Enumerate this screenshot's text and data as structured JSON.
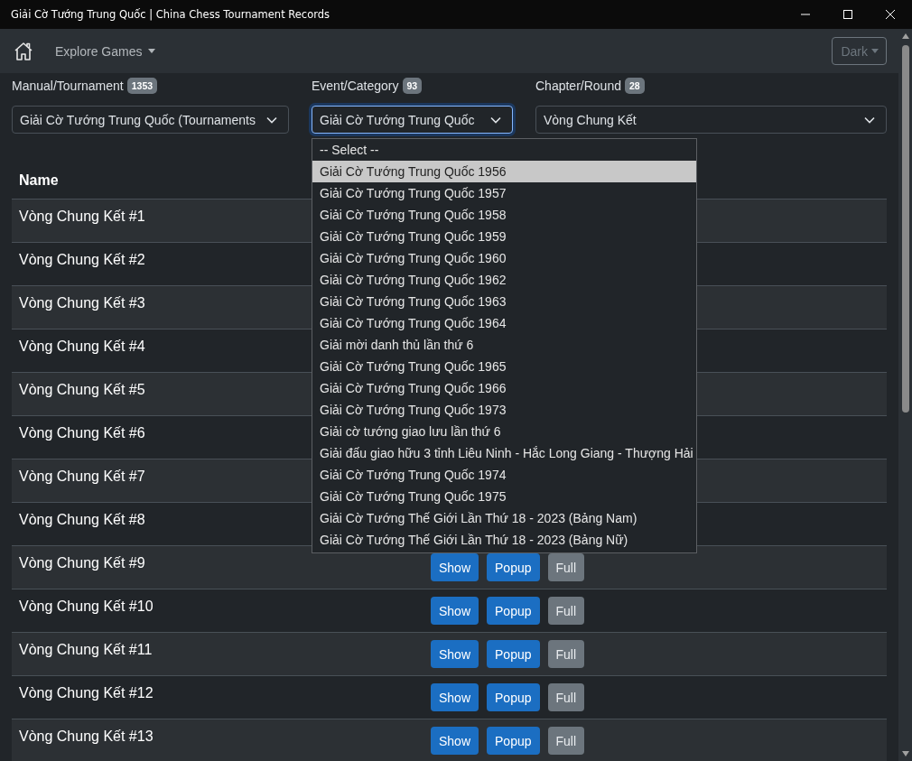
{
  "window": {
    "title": "Giải Cờ Tướng Trung Quốc | China Chess Tournament Records"
  },
  "navbar": {
    "menu": "Explore Games",
    "theme_button": "Dark"
  },
  "filters": [
    {
      "label": "Manual/Tournament",
      "count": "1353",
      "value": "Giải Cờ Tướng Trung Quốc (Tournaments",
      "focused": false
    },
    {
      "label": "Event/Category",
      "count": "93",
      "value": "Giải Cờ Tướng Trung Quốc",
      "focused": true
    },
    {
      "label": "Chapter/Round",
      "count": "28",
      "value": "Vòng Chung Kết",
      "focused": false
    }
  ],
  "dropdown": {
    "options": [
      {
        "label": "-- Select --",
        "selected": false
      },
      {
        "label": "Giải Cờ Tướng Trung Quốc 1956",
        "selected": true
      },
      {
        "label": "Giải Cờ Tướng Trung Quốc 1957",
        "selected": false
      },
      {
        "label": "Giải Cờ Tướng Trung Quốc 1958",
        "selected": false
      },
      {
        "label": "Giải Cờ Tướng Trung Quốc 1959",
        "selected": false
      },
      {
        "label": "Giải Cờ Tướng Trung Quốc 1960",
        "selected": false
      },
      {
        "label": "Giải Cờ Tướng Trung Quốc 1962",
        "selected": false
      },
      {
        "label": "Giải Cờ Tướng Trung Quốc 1963",
        "selected": false
      },
      {
        "label": "Giải Cờ Tướng Trung Quốc 1964",
        "selected": false
      },
      {
        "label": "Giải mời danh thủ lần thứ 6",
        "selected": false
      },
      {
        "label": "Giải Cờ Tướng Trung Quốc 1965",
        "selected": false
      },
      {
        "label": "Giải Cờ Tướng Trung Quốc 1966",
        "selected": false
      },
      {
        "label": "Giải Cờ Tướng Trung Quốc 1973",
        "selected": false
      },
      {
        "label": "Giải cờ tướng giao lưu lần thứ 6",
        "selected": false
      },
      {
        "label": "Giải đấu giao hữu 3 tỉnh Liêu Ninh - Hắc Long Giang - Thượng Hải",
        "selected": false
      },
      {
        "label": "Giải Cờ Tướng Trung Quốc 1974",
        "selected": false
      },
      {
        "label": "Giải Cờ Tướng Trung Quốc 1975",
        "selected": false
      },
      {
        "label": "Giải Cờ Tướng Thế Giới Lần Thứ 18 - 2023 (Bảng Nam)",
        "selected": false
      },
      {
        "label": "Giải Cờ Tướng Thế Giới Lần Thứ 18 - 2023 (Bảng Nữ)",
        "selected": false
      }
    ]
  },
  "table": {
    "columns": [
      "Name"
    ],
    "rows": [
      {
        "name": "Vòng Chung Kết #1"
      },
      {
        "name": "Vòng Chung Kết #2"
      },
      {
        "name": "Vòng Chung Kết #3"
      },
      {
        "name": "Vòng Chung Kết #4"
      },
      {
        "name": "Vòng Chung Kết #5"
      },
      {
        "name": "Vòng Chung Kết #6"
      },
      {
        "name": "Vòng Chung Kết #7"
      },
      {
        "name": "Vòng Chung Kết #8"
      },
      {
        "name": "Vòng Chung Kết #9",
        "buttons": [
          {
            "label": "Show",
            "kind": "primary"
          },
          {
            "label": "Popup",
            "kind": "primary"
          },
          {
            "label": "Full",
            "kind": "secondary"
          }
        ]
      },
      {
        "name": "Vòng Chung Kết #10",
        "buttons": [
          {
            "label": "Show",
            "kind": "primary"
          },
          {
            "label": "Popup",
            "kind": "primary"
          },
          {
            "label": "Full",
            "kind": "secondary"
          }
        ]
      },
      {
        "name": "Vòng Chung Kết #11",
        "buttons": [
          {
            "label": "Show",
            "kind": "primary"
          },
          {
            "label": "Popup",
            "kind": "primary"
          },
          {
            "label": "Full",
            "kind": "secondary"
          }
        ]
      },
      {
        "name": "Vòng Chung Kết #12",
        "buttons": [
          {
            "label": "Show",
            "kind": "primary"
          },
          {
            "label": "Popup",
            "kind": "primary"
          },
          {
            "label": "Full",
            "kind": "secondary"
          }
        ]
      },
      {
        "name": "Vòng Chung Kết #13",
        "buttons": [
          {
            "label": "Show",
            "kind": "primary"
          },
          {
            "label": "Popup",
            "kind": "primary"
          },
          {
            "label": "Full",
            "kind": "secondary"
          }
        ]
      }
    ]
  }
}
